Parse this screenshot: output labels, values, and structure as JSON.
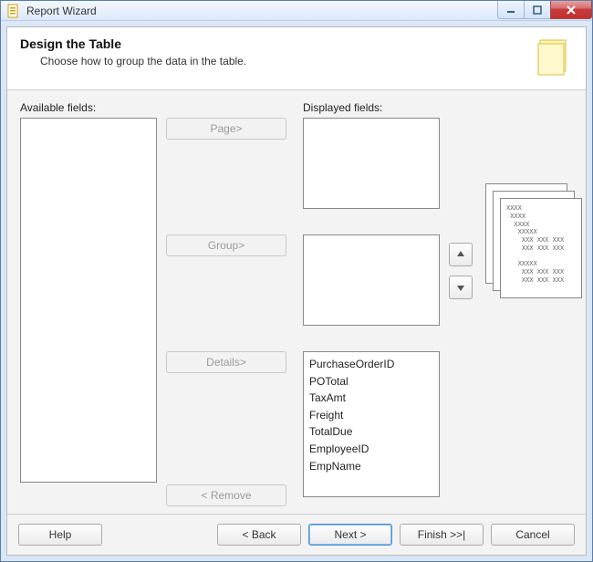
{
  "window": {
    "title": "Report Wizard"
  },
  "header": {
    "title": "Design the Table",
    "subtitle": "Choose how to group the data in the table."
  },
  "labels": {
    "available": "Available fields:",
    "displayed": "Displayed fields:"
  },
  "buttons": {
    "page": "Page>",
    "group": "Group>",
    "details": "Details>",
    "remove": "< Remove",
    "help": "Help",
    "back": "< Back",
    "next": "Next >",
    "finish": "Finish >>|",
    "cancel": "Cancel"
  },
  "details_fields": [
    "PurchaseOrderID",
    "POTotal",
    "TaxAmt",
    "Freight",
    "TotalDue",
    "EmployeeID",
    "EmpName"
  ],
  "preview_text": "XXXX\n XXXX\n  XXXX\n   XXXXX\n    XXX XXX XXX\n    XXX XXX XXX\n\n   XXXXX\n    XXX XXX XXX\n    XXX XXX XXX"
}
